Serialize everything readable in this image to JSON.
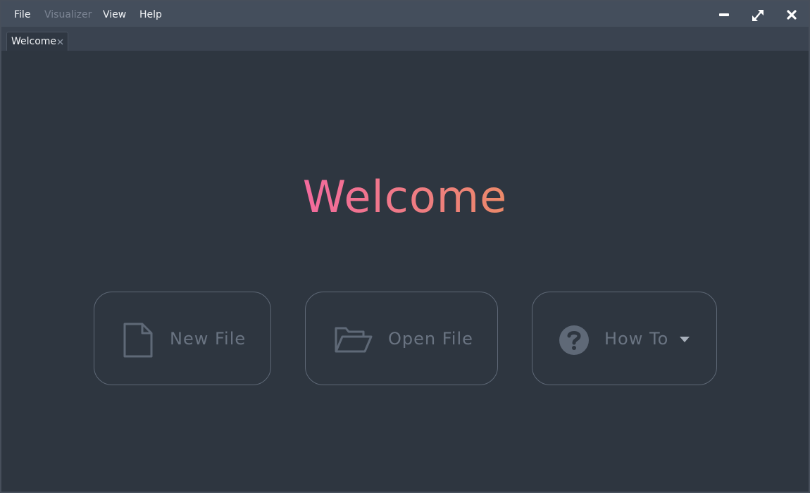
{
  "menubar": {
    "items": [
      {
        "label": "File",
        "enabled": true
      },
      {
        "label": "Visualizer",
        "enabled": false
      },
      {
        "label": "View",
        "enabled": true
      },
      {
        "label": "Help",
        "enabled": true
      }
    ],
    "window_controls": [
      "minimize-icon",
      "maximize-icon",
      "close-icon"
    ]
  },
  "tabs": [
    {
      "label": "Welcome",
      "active": true,
      "closable": true
    }
  ],
  "main": {
    "title": "Welcome",
    "title_gradient": [
      "#f36a9d",
      "#ec8a69"
    ],
    "actions": [
      {
        "label": "New File",
        "icon": "new-file-icon"
      },
      {
        "label": "Open File",
        "icon": "open-folder-icon"
      },
      {
        "label": "How To",
        "icon": "help-circle-icon",
        "dropdown": true
      }
    ]
  },
  "colors": {
    "background": "#2e3640",
    "menubar": "#444e5c",
    "tabbar": "#3a4350",
    "button_border": "#5e6876",
    "button_text": "#6a7482"
  }
}
